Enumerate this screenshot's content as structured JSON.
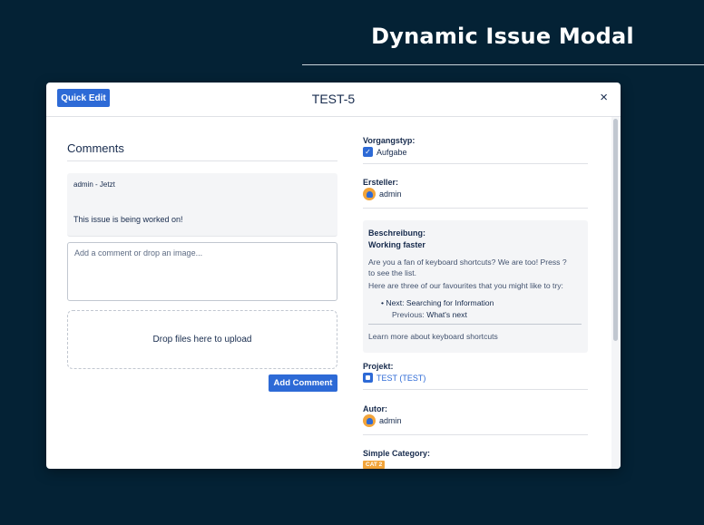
{
  "hero": {
    "title": "Dynamic Issue Modal"
  },
  "header": {
    "quick_edit_label": "Quick Edit",
    "issue_key": "TEST-5",
    "close_glyph": "×"
  },
  "comments": {
    "title": "Comments",
    "items": [
      {
        "meta": "admin - Jetzt",
        "text": "This issue is being worked on!"
      }
    ],
    "input_placeholder": "Add a comment or drop an image...",
    "dropzone_text": "Drop files here to upload",
    "add_button_label": "Add Comment"
  },
  "fields": {
    "issue_type": {
      "label": "Vorgangstyp:",
      "value": "Aufgabe",
      "icon": "check-icon"
    },
    "reporter": {
      "label": "Ersteller:",
      "value": "admin",
      "icon": "avatar-icon"
    },
    "description": {
      "label": "Beschreibung:",
      "heading": "Working faster",
      "line1": "Are you a fan of keyboard shortcuts? We are too! Press  ?",
      "line2": "to see the list.",
      "line3": "Here are three of our favourites that you might like to try:",
      "bullet_next": "Next: Searching for Information",
      "previous_label": "Previous:",
      "previous_value": "What's next",
      "link_text": "Learn more about keyboard shortcuts"
    },
    "project": {
      "label": "Projekt:",
      "value": "TEST (TEST)",
      "icon": "project-icon"
    },
    "author": {
      "label": "Autor:",
      "value": "admin",
      "icon": "avatar-icon"
    },
    "category": {
      "label": "Simple Category:",
      "badge": "CAT 2"
    }
  },
  "colors": {
    "background": "#042235",
    "accent": "#2d6ad6",
    "badge": "#f2a43a"
  }
}
